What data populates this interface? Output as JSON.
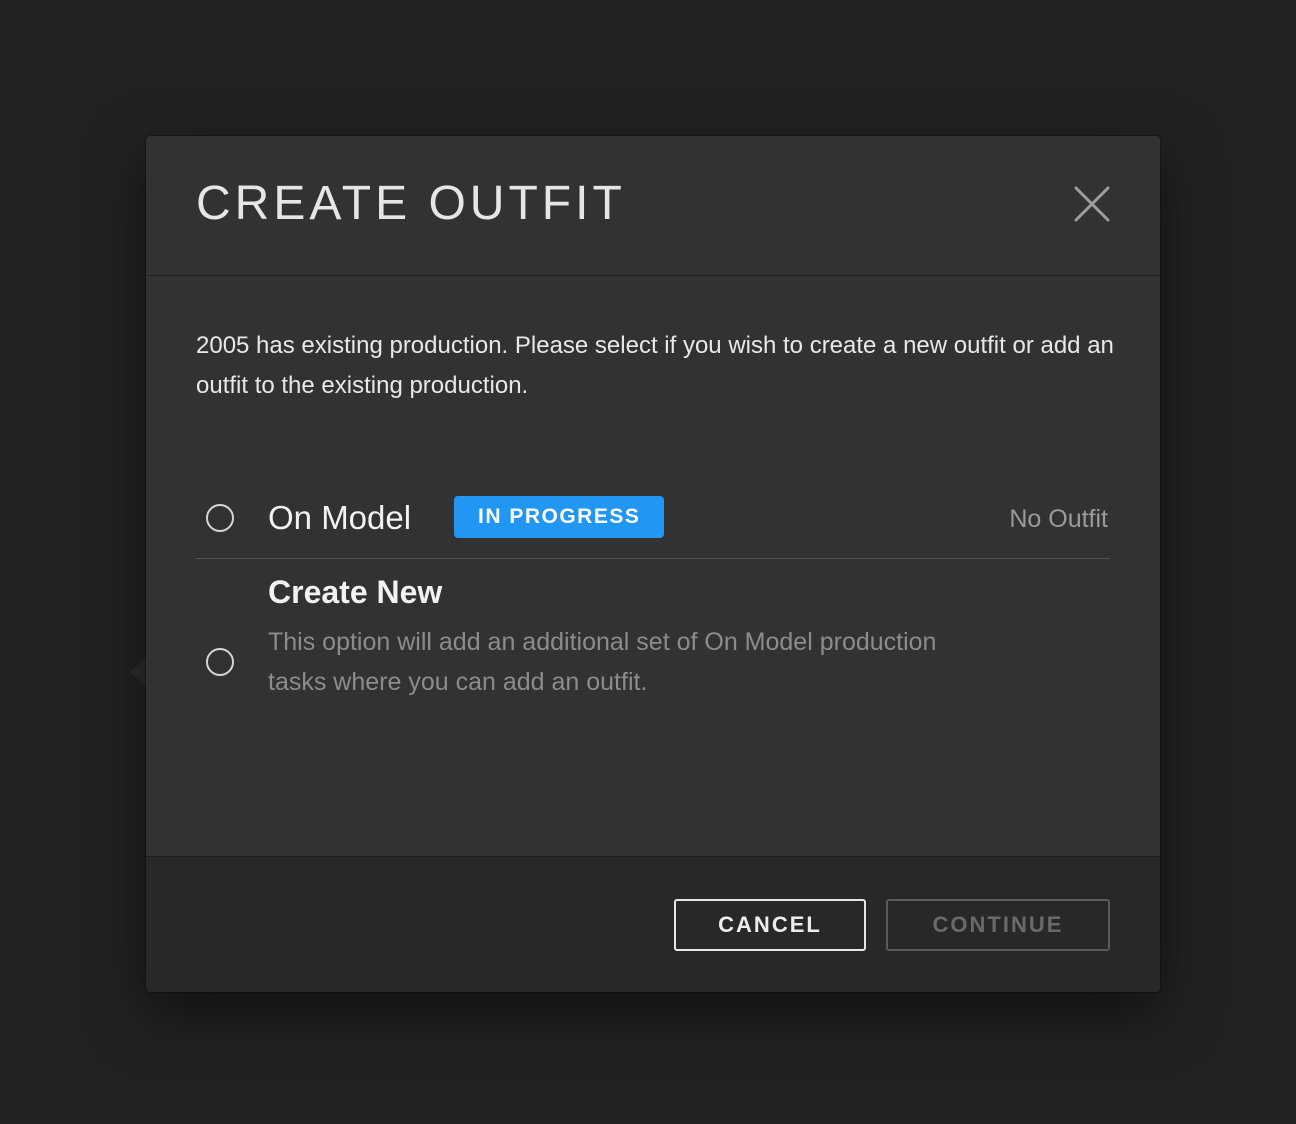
{
  "modal": {
    "title": "CREATE OUTFIT",
    "intro_text": "2005 has existing production. Please select if you wish to create a new outfit or add an outfit to the existing production."
  },
  "options": [
    {
      "label": "On Model",
      "badge": "IN PROGRESS",
      "meta": "No Outfit",
      "selected": false
    },
    {
      "label": "Create New",
      "description": "This option will add an additional set of On Model production tasks where you can add an outfit.",
      "selected": false
    }
  ],
  "footer": {
    "cancel_label": "CANCEL",
    "continue_label": "CONTINUE",
    "continue_disabled": true
  },
  "colors": {
    "badge_blue": "#2196f3",
    "modal_bg": "#323232",
    "footer_bg": "#282828",
    "page_bg": "#222222"
  },
  "icons": {
    "close": "close-icon",
    "radio": "radio-unchecked-icon"
  }
}
